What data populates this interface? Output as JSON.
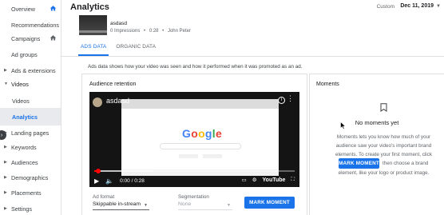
{
  "sidebar": {
    "items": [
      {
        "label": "Overview"
      },
      {
        "label": "Recommendations"
      },
      {
        "label": "Campaigns"
      },
      {
        "label": "Ad groups"
      },
      {
        "label": "Ads & extensions"
      },
      {
        "label": "Videos"
      },
      {
        "label": "Videos"
      },
      {
        "label": "Analytics"
      },
      {
        "label": "Landing pages"
      },
      {
        "label": "Keywords"
      },
      {
        "label": "Audiences"
      },
      {
        "label": "Demographics"
      },
      {
        "label": "Placements"
      },
      {
        "label": "Settings"
      }
    ]
  },
  "header": {
    "title": "Analytics",
    "date_label": "Custom",
    "date_value": "Dec 11, 2019"
  },
  "ad": {
    "name": "asdasd",
    "impressions": "0 Impressions",
    "separator": "•",
    "duration": "0:28",
    "owner": "John Peter"
  },
  "tabs": [
    {
      "label": "ADS DATA"
    },
    {
      "label": "ORGANIC DATA"
    }
  ],
  "description": "Ads data shows how your video was seen and how it performed when it was promoted as an ad.",
  "retention": {
    "title": "Audience retention",
    "video": {
      "title": "asdasd",
      "current_time": "0:00",
      "time_separator": "/",
      "total_time": "0:28",
      "brand": "YouTube",
      "search_logo": "Google",
      "played_fraction": 0.02,
      "buffered_fraction": 0.3
    },
    "ad_format_label": "Ad format",
    "ad_format_value": "Skippable in-stream",
    "segmentation_label": "Segmentation",
    "segmentation_value": "None",
    "mark_moment_button": "MARK MOMENT"
  },
  "moments": {
    "title": "Moments",
    "empty_title": "No moments yet",
    "text_line1": "Moments lets you know how much of your",
    "text_line2": "audience saw your video's important brand",
    "text_line3": "elements. To create your first moment, click",
    "inline_button": "MARK MOMENT",
    "text_line4_after": "then choose a brand",
    "text_line5": "element, like your logo or product image."
  },
  "colors": {
    "accent": "#1a73e8",
    "progress": "#ff0000"
  }
}
